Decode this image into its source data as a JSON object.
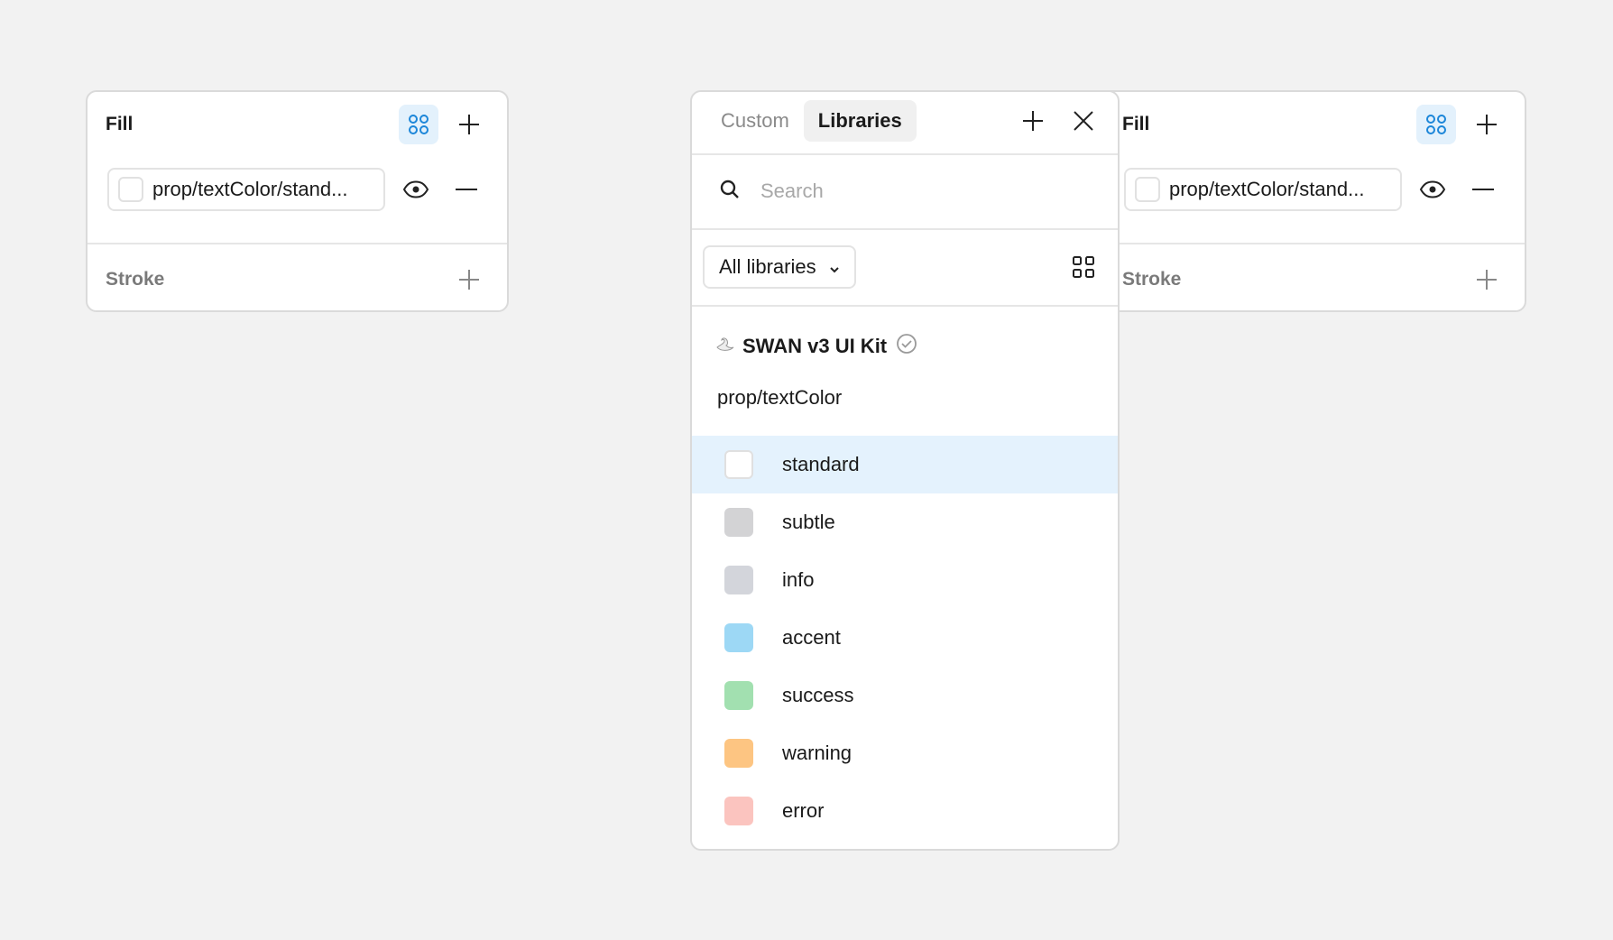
{
  "fill_panel": {
    "title": "Fill",
    "style_name": "prop/textColor/stand...",
    "stroke_title": "Stroke"
  },
  "picker": {
    "tabs": [
      "Custom",
      "Libraries"
    ],
    "search_placeholder": "Search",
    "library_filter": "All libraries",
    "library_name": "SWAN v3 UI Kit",
    "group": "prop/textColor",
    "colors": [
      {
        "name": "standard",
        "color": "#ffffff",
        "selected": true
      },
      {
        "name": "subtle",
        "color": "#d3d3d5"
      },
      {
        "name": "info",
        "color": "#d3d5db"
      },
      {
        "name": "accent",
        "color": "#9dd8f5"
      },
      {
        "name": "success",
        "color": "#a2e0b0"
      },
      {
        "name": "warning",
        "color": "#fdc582"
      },
      {
        "name": "error",
        "color": "#fbc4bf"
      }
    ]
  },
  "colors": {
    "accent_blue": "#1c86d9",
    "selected_row_bg": "#e4f2fd"
  },
  "icons": [
    "styles-grid-icon",
    "plus-icon",
    "eye-icon",
    "minus-icon",
    "close-icon",
    "search-icon",
    "chevron-down-icon",
    "grid-view-icon",
    "swan-icon",
    "verified-check-icon"
  ]
}
